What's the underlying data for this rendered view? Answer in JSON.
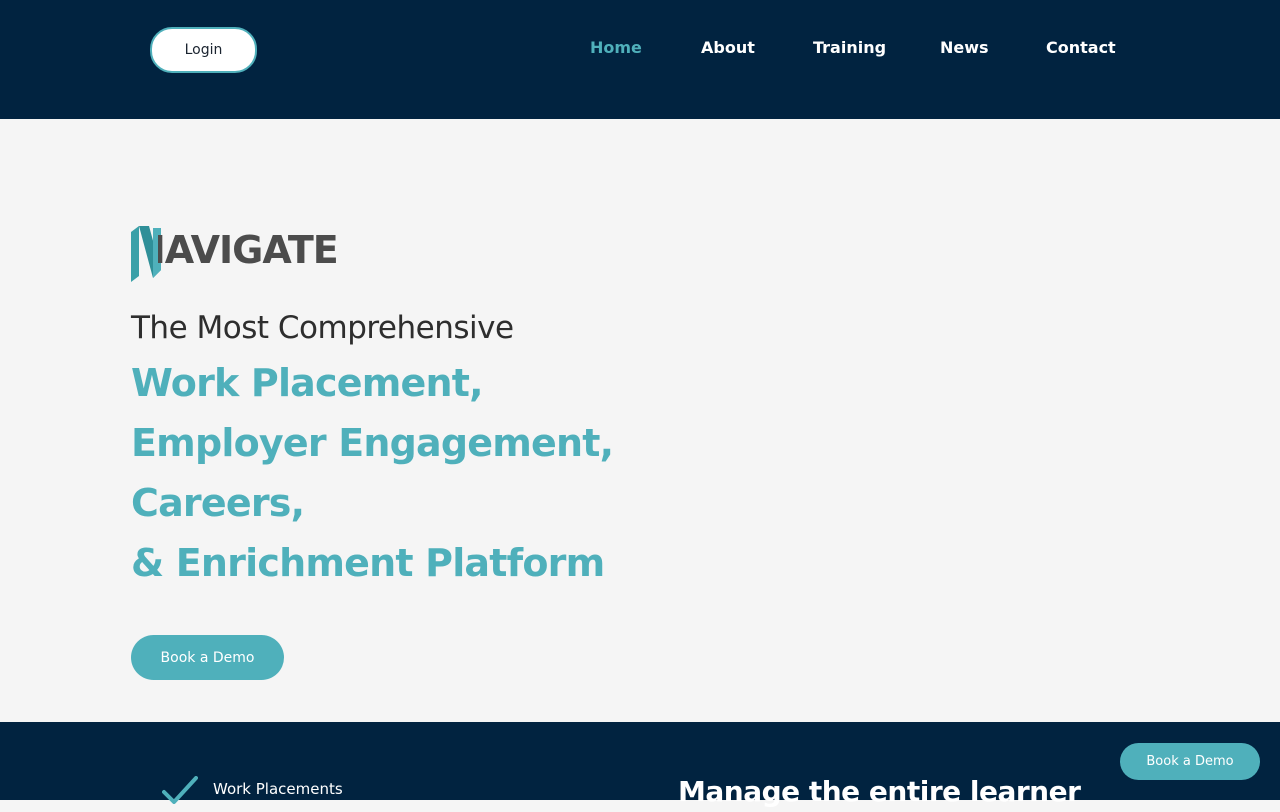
{
  "header": {
    "login_label": "Login",
    "nav": [
      {
        "label": "Home",
        "active": true
      },
      {
        "label": "About",
        "active": false
      },
      {
        "label": "Training",
        "active": false
      },
      {
        "label": "News",
        "active": false
      },
      {
        "label": "Contact",
        "active": false
      }
    ]
  },
  "hero": {
    "logo_text": "NAVIGATE",
    "subtitle": "The Most Comprehensive",
    "headline_lines": [
      "Work Placement,",
      "Employer Engagement,",
      "Careers,",
      "& Enrichment Platform"
    ],
    "cta_label": "Book a Demo"
  },
  "features": {
    "items": [
      "Work Placements"
    ],
    "heading": "Manage the entire learner"
  },
  "floating_cta": {
    "label": "Book a Demo"
  },
  "colors": {
    "navy": "#012340",
    "teal": "#4fb0bb",
    "grey_text": "#4c4c4c",
    "background": "#f5f5f5"
  },
  "icons": [
    "navigate-logo-icon",
    "checkmark-icon"
  ]
}
